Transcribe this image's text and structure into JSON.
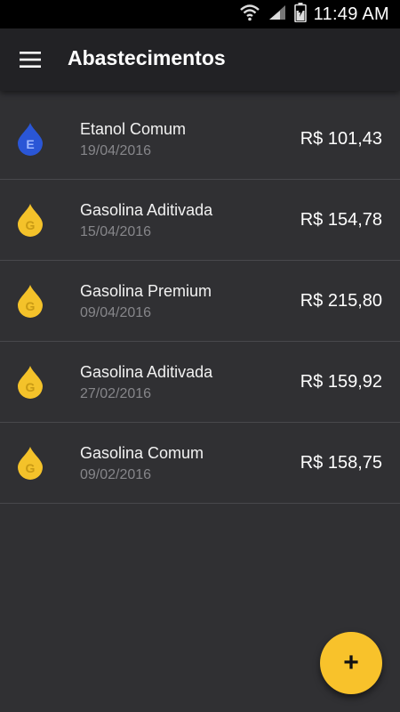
{
  "status_bar": {
    "time": "11:49 AM",
    "icons": [
      "wifi-icon",
      "signal-icon",
      "battery-icon"
    ]
  },
  "app_bar": {
    "title": "Abastecimentos",
    "menu_icon": "menu-icon"
  },
  "entries": [
    {
      "icon_letter": "E",
      "icon_color": "#2a56d6",
      "name": "Etanol Comum",
      "date": "19/04/2016",
      "price": "R$ 101,43"
    },
    {
      "icon_letter": "G",
      "icon_color": "#f4c22a",
      "name": "Gasolina Aditivada",
      "date": "15/04/2016",
      "price": "R$ 154,78"
    },
    {
      "icon_letter": "G",
      "icon_color": "#f4c22a",
      "name": "Gasolina Premium",
      "date": "09/04/2016",
      "price": "R$ 215,80"
    },
    {
      "icon_letter": "G",
      "icon_color": "#f4c22a",
      "name": "Gasolina Aditivada",
      "date": "27/02/2016",
      "price": "R$ 159,92"
    },
    {
      "icon_letter": "G",
      "icon_color": "#f4c22a",
      "name": "Gasolina Comum",
      "date": "09/02/2016",
      "price": "R$ 158,75"
    }
  ],
  "fab": {
    "label": "+",
    "color": "#f8c22b"
  }
}
